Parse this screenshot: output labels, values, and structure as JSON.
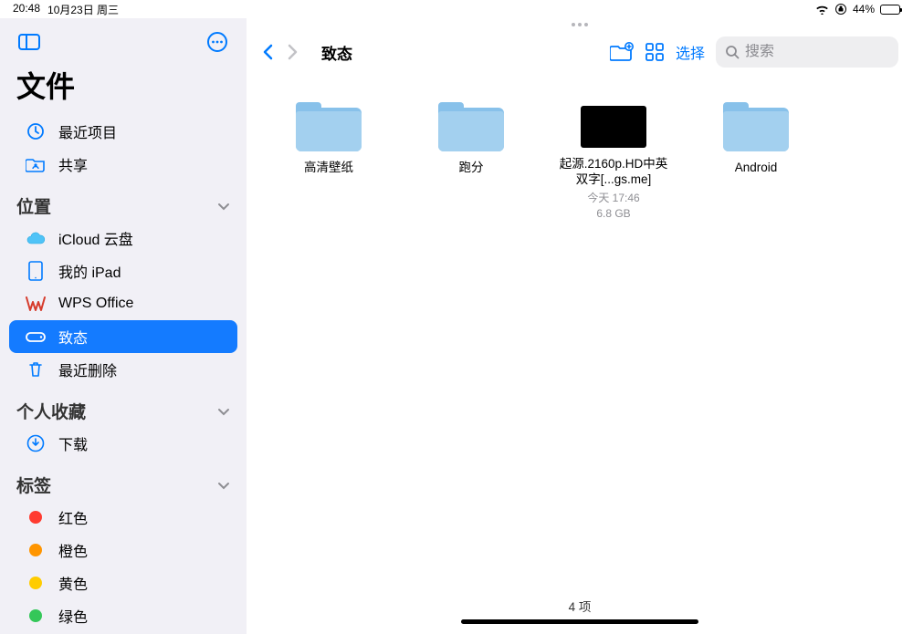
{
  "status": {
    "time": "20:48",
    "date": "10月23日 周三",
    "battery_text": "44%",
    "battery_level": 44
  },
  "sidebar": {
    "app_title": "文件",
    "recent_label": "最近项目",
    "shared_label": "共享",
    "locations_header": "位置",
    "locations": [
      {
        "label": "iCloud 云盘",
        "icon": "icloud"
      },
      {
        "label": "我的 iPad",
        "icon": "ipad"
      },
      {
        "label": "WPS Office",
        "icon": "wps"
      },
      {
        "label": "致态",
        "icon": "drive",
        "selected": true
      },
      {
        "label": "最近删除",
        "icon": "trash"
      }
    ],
    "favorites_header": "个人收藏",
    "favorites": [
      {
        "label": "下载",
        "icon": "download"
      }
    ],
    "tags_header": "标签",
    "tags": [
      {
        "label": "红色",
        "color": "#ff3b30"
      },
      {
        "label": "橙色",
        "color": "#ff9500"
      },
      {
        "label": "黄色",
        "color": "#ffcc00"
      },
      {
        "label": "绿色",
        "color": "#34c759"
      }
    ]
  },
  "main": {
    "breadcrumb_title": "致态",
    "select_label": "选择",
    "search_placeholder": "搜索",
    "items": [
      {
        "type": "folder",
        "name": "高清壁纸"
      },
      {
        "type": "folder",
        "name": "跑分"
      },
      {
        "type": "video",
        "name": "起源.2160p.HD中英双字[...gs.me]",
        "date": "今天 17:46",
        "size": "6.8 GB"
      },
      {
        "type": "folder",
        "name": "Android"
      }
    ],
    "footer_count": "4 项"
  }
}
